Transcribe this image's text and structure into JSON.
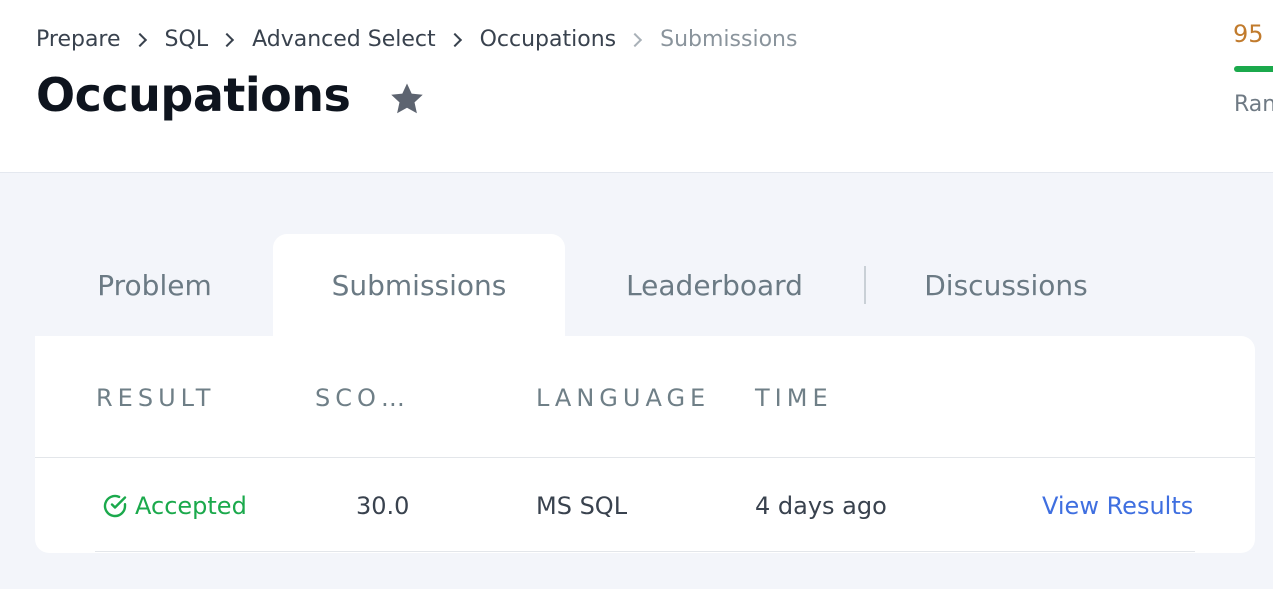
{
  "breadcrumb": [
    "Prepare",
    "SQL",
    "Advanced Select",
    "Occupations",
    "Submissions"
  ],
  "page": {
    "title": "Occupations"
  },
  "profile": {
    "score": "95",
    "rank_label": "Ran",
    "progress_percent": 100
  },
  "tabs": [
    {
      "label": "Problem",
      "active": false
    },
    {
      "label": "Submissions",
      "active": true
    },
    {
      "label": "Leaderboard",
      "active": false
    },
    {
      "label": "Discussions",
      "active": false
    }
  ],
  "table": {
    "columns": [
      "RESULT",
      "SCO…",
      "LANGUAGE",
      "TIME"
    ],
    "rows": [
      {
        "result": "Accepted",
        "score": "30.0",
        "language": "MS SQL",
        "time": "4 days ago",
        "action": "View Results"
      }
    ]
  },
  "colors": {
    "accepted": "#1ba94c",
    "link": "#3f6fe0",
    "score": "#c17b2d"
  }
}
